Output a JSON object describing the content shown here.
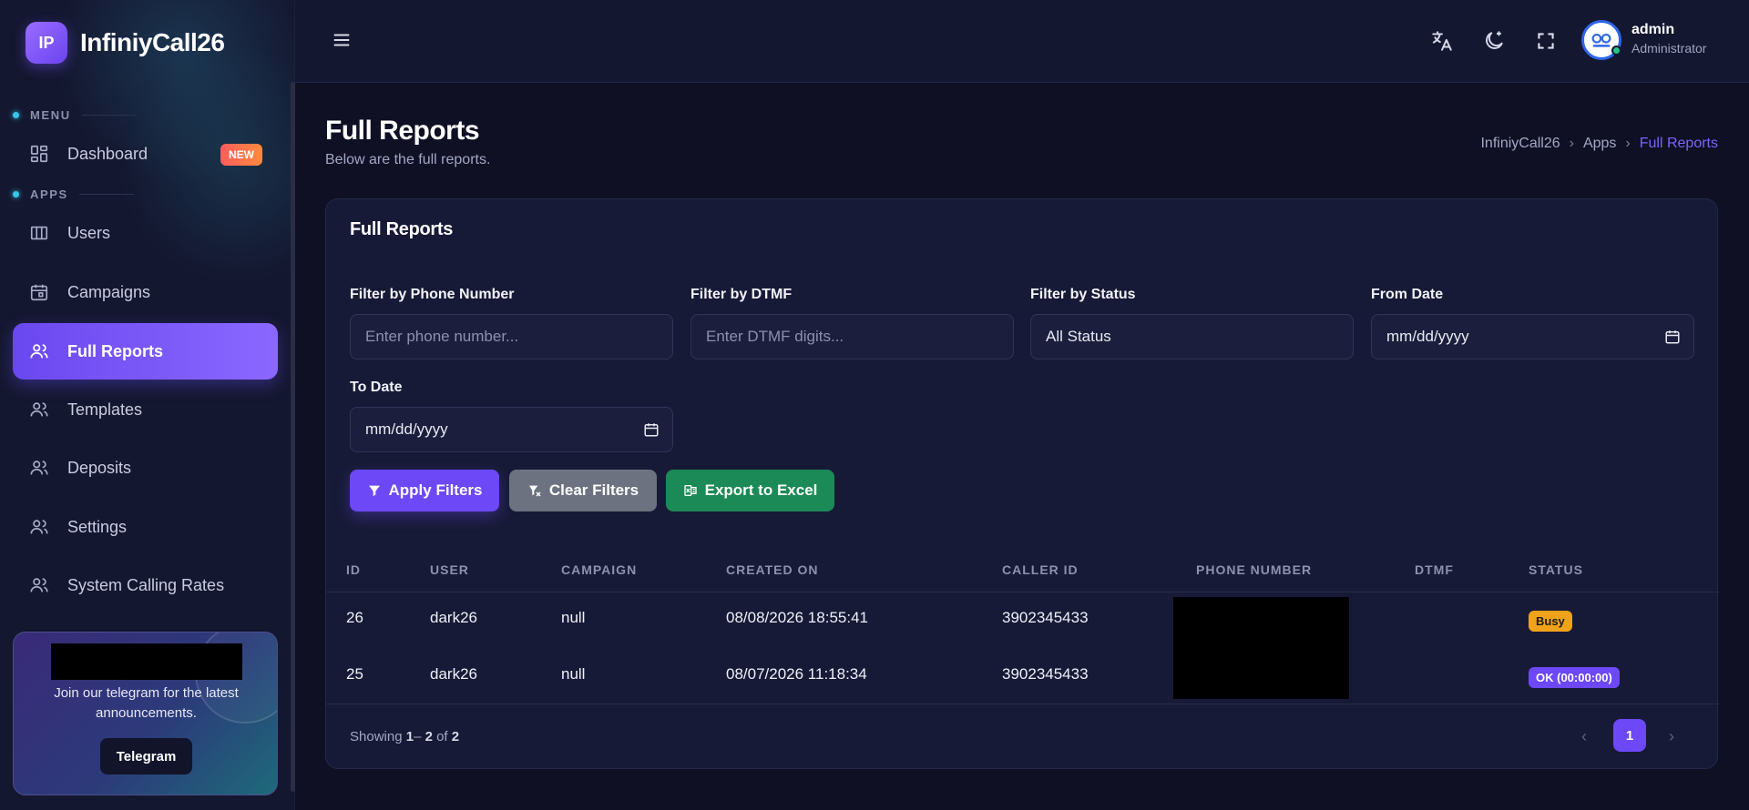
{
  "brand": {
    "logo_text": "IP",
    "name": "InfiniyCall26"
  },
  "sidebar": {
    "section_menu": "MENU",
    "section_apps": "APPS",
    "items": [
      {
        "label": "Dashboard",
        "icon": "dashboard-icon",
        "badge": "NEW"
      },
      {
        "label": "Users",
        "icon": "columns-icon"
      },
      {
        "label": "Campaigns",
        "icon": "calendar-icon"
      },
      {
        "label": "Full Reports",
        "icon": "users-icon",
        "active": true
      },
      {
        "label": "Templates",
        "icon": "users-icon"
      },
      {
        "label": "Deposits",
        "icon": "users-icon"
      },
      {
        "label": "Settings",
        "icon": "users-icon"
      },
      {
        "label": "System Calling Rates",
        "icon": "users-icon"
      }
    ],
    "promo": {
      "text": "Join our telegram for the latest announcements.",
      "button": "Telegram"
    }
  },
  "topbar": {
    "icons": [
      "menu-icon",
      "translate-icon",
      "theme-moon-icon",
      "fullscreen-icon"
    ],
    "user": {
      "name": "admin",
      "role": "Administrator"
    }
  },
  "page": {
    "title": "Full Reports",
    "subtitle": "Below are the full reports.",
    "breadcrumb": [
      "InfiniyCall26",
      "Apps",
      "Full Reports"
    ]
  },
  "card": {
    "title": "Full Reports",
    "filters": {
      "phone": {
        "label": "Filter by Phone Number",
        "placeholder": "Enter phone number..."
      },
      "dtmf": {
        "label": "Filter by DTMF",
        "placeholder": "Enter DTMF digits..."
      },
      "status": {
        "label": "Filter by Status",
        "value": "All Status"
      },
      "from": {
        "label": "From Date",
        "placeholder": "mm/dd/yyyy"
      },
      "to": {
        "label": "To Date",
        "placeholder": "mm/dd/yyyy"
      }
    },
    "buttons": {
      "apply": "Apply Filters",
      "clear": "Clear Filters",
      "export": "Export to Excel"
    },
    "table": {
      "columns": [
        "ID",
        "USER",
        "CAMPAIGN",
        "CREATED ON",
        "CALLER ID",
        "PHONE NUMBER",
        "DTMF",
        "STATUS"
      ],
      "rows": [
        {
          "id": "26",
          "user": "dark26",
          "campaign": "null",
          "created": "08/08/2026 18:55:41",
          "caller_id": "3902345433",
          "phone": "",
          "dtmf": "",
          "status": "Busy"
        },
        {
          "id": "25",
          "user": "dark26",
          "campaign": "null",
          "created": "08/07/2026 11:18:34",
          "caller_id": "3902345433",
          "phone": "",
          "dtmf": "",
          "status": "OK (00:00:00)"
        }
      ]
    },
    "footer": {
      "showing_prefix": "Showing",
      "from": "1",
      "dash": "–",
      "to": "2",
      "of_word": "of",
      "total": "2",
      "current_page": "1"
    }
  },
  "colors": {
    "accent": "#6c48f6",
    "busy": "#f0a21a",
    "export": "#1c8a56",
    "clear": "#6c727f",
    "background": "#0f1024"
  }
}
